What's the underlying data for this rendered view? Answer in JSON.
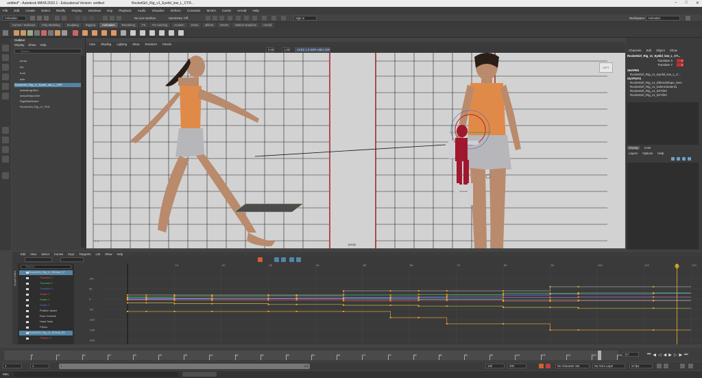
{
  "window": {
    "title": "untitled* - Autodesk MAYA 2022.1 - Educational Version: untitled",
    "file_tab": "RocketGirl_Rig_v1_Eyelid_low_L_CTR..."
  },
  "menubar": [
    "File",
    "Edit",
    "Create",
    "Select",
    "Modify",
    "Display",
    "Windows",
    "Key",
    "Playback",
    "Audio",
    "Visualize",
    "Deform",
    "Constrain",
    "MASH",
    "Cache",
    "Arnold",
    "Help"
  ],
  "status": {
    "mode": "Animation",
    "no_live": "No Live Surface",
    "symmetry": "Symmetry: Off",
    "signin": "Sign In",
    "workspace_label": "Workspace:",
    "workspace": "Animation"
  },
  "shelf_tabs": [
    "Curves / Surfaces",
    "Poly Modeling",
    "Sculpting",
    "Rigging",
    "Animation",
    "Rendering",
    "FX",
    "FX Caching",
    "Custom",
    "XGen",
    "Bifrost",
    "MASH",
    "Motion Graphics",
    "Arnold"
  ],
  "shelf_active": "Animation",
  "outliner": {
    "title": "Outliner",
    "menu": [
      "Display",
      "Show",
      "Help"
    ],
    "search": "Search...",
    "items": [
      "persp",
      "top",
      "front",
      "side",
      "RocketGirl_Rig_v1_Eyelid_low_L_CRP",
      "defaultLightSet",
      "defaultObjectSet",
      "RightBallSelbot",
      "RocketGirl_Rig_v1_FKN"
    ]
  },
  "viewport": {
    "menu": [
      "View",
      "Shading",
      "Lighting",
      "Show",
      "Renderer",
      "Panels"
    ],
    "field1": "0.00",
    "field2": "1.00",
    "colorspace": "ACES 1.0 SDR-video (sRGB)",
    "cam_label": "persp",
    "view_cube": "LEFT"
  },
  "channelbox": {
    "tabs": [
      "Channels",
      "Edit",
      "Object",
      "Show"
    ],
    "node": "RocketGirl_Rig_v1_Eyelid_low_L_CT...",
    "attrs": [
      {
        "name": "Translate X",
        "value": "0"
      },
      {
        "name": "Translate Y",
        "value": "0"
      }
    ],
    "shapes_label": "SHAPES",
    "shape": "RocketGirl_Rig_v1_Eyelid_low_L_C...",
    "outputs_label": "OUTPUTS",
    "outputs": [
      "RocketGirl_Rig_v1_Eblendshape_Item",
      "RocketGirl_Rig_v1_EskinCluster31",
      "RocketGirl_Rig_v1_EriTil20",
      "RocketGirl_Rig_v1_EriTil22"
    ],
    "layer_tabs": [
      "Display",
      "Anim"
    ],
    "layer_menu": [
      "Layers",
      "Options",
      "Help"
    ]
  },
  "graph_editor": {
    "menu": [
      "Edit",
      "View",
      "Select",
      "Curves",
      "Keys",
      "Tangents",
      "List",
      "Show",
      "Help"
    ],
    "side_label": "Graph Editor",
    "search": "Search...",
    "channels": [
      {
        "name": "RocketGirl_Rig_v1_Ethead_CT",
        "color": "#dddddd",
        "sel": true
      },
      {
        "name": "Translate X",
        "color": "#e05050",
        "sel": false
      },
      {
        "name": "Translate Y",
        "color": "#50c050",
        "sel": false
      },
      {
        "name": "Translate Z",
        "color": "#5070e0",
        "sel": false
      },
      {
        "name": "Rotate X",
        "color": "#e05050",
        "sel": false
      },
      {
        "name": "Rotate Y",
        "color": "#50c050",
        "sel": false
      },
      {
        "name": "Rotate Z",
        "color": "#5070e0",
        "sel": false
      },
      {
        "name": "Position Space",
        "color": "#cccccc",
        "sel": false
      },
      {
        "name": "Face Controls",
        "color": "#cccccc",
        "sel": false
      },
      {
        "name": "Head Twist",
        "color": "#cccccc",
        "sel": false
      },
      {
        "name": "Follow",
        "color": "#cccccc",
        "sel": false
      },
      {
        "name": "RocketGirl_Rig_v1_Ethead_BK",
        "color": "#dddddd",
        "sel": true
      },
      {
        "name": "Position X",
        "color": "#e05050",
        "sel": false
      }
    ],
    "y_ticks": [
      "100",
      "50",
      "0",
      "-50",
      "-100",
      "-150",
      "-200"
    ],
    "x_ticks": [
      "10",
      "20",
      "30",
      "40",
      "50",
      "60",
      "70",
      "80",
      "90",
      "100",
      "110",
      "120"
    ],
    "current_frame": "117"
  },
  "timeline": {
    "ticks": [
      "5",
      "10",
      "15",
      "20",
      "25",
      "30",
      "35",
      "40",
      "45",
      "50",
      "55",
      "60",
      "65",
      "70",
      "75",
      "80",
      "85",
      "90",
      "95",
      "100",
      "105",
      "110",
      "115",
      "120"
    ],
    "current": "117",
    "range_start": "1",
    "range_start2": "1",
    "range_end": "120",
    "range_end2": "120",
    "range_field": "120",
    "range_field2": "200",
    "char_set": "No Character Set",
    "anim_layer": "No Anim Layer",
    "fps": "24 fps"
  },
  "cmdline": {
    "label": "MEL"
  },
  "colors": {
    "maya_blue": "#5285a6",
    "guide_red": "#a02020",
    "accent_yellow": "#e8c028",
    "key_orange": "#f0a030"
  }
}
